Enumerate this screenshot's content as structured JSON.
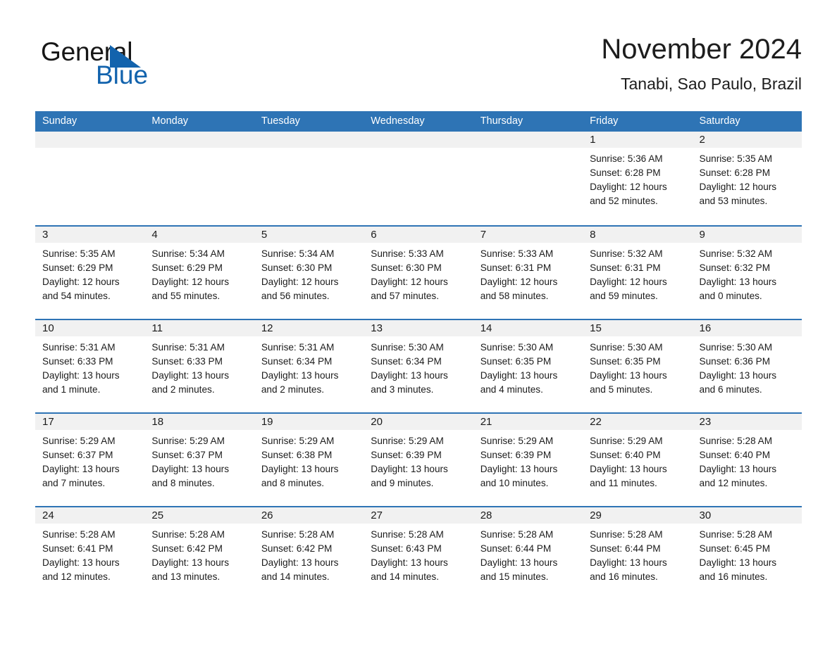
{
  "logo": {
    "word_one": "General",
    "word_two": "Blue",
    "triangle_icon": "triangle-icon",
    "colors": {
      "black": "#161616",
      "blue": "#1263ad"
    }
  },
  "header": {
    "title": "November 2024",
    "subtitle": "Tanabi, Sao Paulo, Brazil"
  },
  "theme": {
    "header_blue": "#2e74b5",
    "day_band_gray": "#f1f1f1",
    "text": "#1b1b1b"
  },
  "weekdays": [
    "Sunday",
    "Monday",
    "Tuesday",
    "Wednesday",
    "Thursday",
    "Friday",
    "Saturday"
  ],
  "weeks": [
    [
      {
        "day": "",
        "lines": []
      },
      {
        "day": "",
        "lines": []
      },
      {
        "day": "",
        "lines": []
      },
      {
        "day": "",
        "lines": []
      },
      {
        "day": "",
        "lines": []
      },
      {
        "day": "1",
        "lines": [
          "Sunrise: 5:36 AM",
          "Sunset: 6:28 PM",
          "Daylight: 12 hours",
          "and 52 minutes."
        ]
      },
      {
        "day": "2",
        "lines": [
          "Sunrise: 5:35 AM",
          "Sunset: 6:28 PM",
          "Daylight: 12 hours",
          "and 53 minutes."
        ]
      }
    ],
    [
      {
        "day": "3",
        "lines": [
          "Sunrise: 5:35 AM",
          "Sunset: 6:29 PM",
          "Daylight: 12 hours",
          "and 54 minutes."
        ]
      },
      {
        "day": "4",
        "lines": [
          "Sunrise: 5:34 AM",
          "Sunset: 6:29 PM",
          "Daylight: 12 hours",
          "and 55 minutes."
        ]
      },
      {
        "day": "5",
        "lines": [
          "Sunrise: 5:34 AM",
          "Sunset: 6:30 PM",
          "Daylight: 12 hours",
          "and 56 minutes."
        ]
      },
      {
        "day": "6",
        "lines": [
          "Sunrise: 5:33 AM",
          "Sunset: 6:30 PM",
          "Daylight: 12 hours",
          "and 57 minutes."
        ]
      },
      {
        "day": "7",
        "lines": [
          "Sunrise: 5:33 AM",
          "Sunset: 6:31 PM",
          "Daylight: 12 hours",
          "and 58 minutes."
        ]
      },
      {
        "day": "8",
        "lines": [
          "Sunrise: 5:32 AM",
          "Sunset: 6:31 PM",
          "Daylight: 12 hours",
          "and 59 minutes."
        ]
      },
      {
        "day": "9",
        "lines": [
          "Sunrise: 5:32 AM",
          "Sunset: 6:32 PM",
          "Daylight: 13 hours",
          "and 0 minutes."
        ]
      }
    ],
    [
      {
        "day": "10",
        "lines": [
          "Sunrise: 5:31 AM",
          "Sunset: 6:33 PM",
          "Daylight: 13 hours",
          "and 1 minute."
        ]
      },
      {
        "day": "11",
        "lines": [
          "Sunrise: 5:31 AM",
          "Sunset: 6:33 PM",
          "Daylight: 13 hours",
          "and 2 minutes."
        ]
      },
      {
        "day": "12",
        "lines": [
          "Sunrise: 5:31 AM",
          "Sunset: 6:34 PM",
          "Daylight: 13 hours",
          "and 2 minutes."
        ]
      },
      {
        "day": "13",
        "lines": [
          "Sunrise: 5:30 AM",
          "Sunset: 6:34 PM",
          "Daylight: 13 hours",
          "and 3 minutes."
        ]
      },
      {
        "day": "14",
        "lines": [
          "Sunrise: 5:30 AM",
          "Sunset: 6:35 PM",
          "Daylight: 13 hours",
          "and 4 minutes."
        ]
      },
      {
        "day": "15",
        "lines": [
          "Sunrise: 5:30 AM",
          "Sunset: 6:35 PM",
          "Daylight: 13 hours",
          "and 5 minutes."
        ]
      },
      {
        "day": "16",
        "lines": [
          "Sunrise: 5:30 AM",
          "Sunset: 6:36 PM",
          "Daylight: 13 hours",
          "and 6 minutes."
        ]
      }
    ],
    [
      {
        "day": "17",
        "lines": [
          "Sunrise: 5:29 AM",
          "Sunset: 6:37 PM",
          "Daylight: 13 hours",
          "and 7 minutes."
        ]
      },
      {
        "day": "18",
        "lines": [
          "Sunrise: 5:29 AM",
          "Sunset: 6:37 PM",
          "Daylight: 13 hours",
          "and 8 minutes."
        ]
      },
      {
        "day": "19",
        "lines": [
          "Sunrise: 5:29 AM",
          "Sunset: 6:38 PM",
          "Daylight: 13 hours",
          "and 8 minutes."
        ]
      },
      {
        "day": "20",
        "lines": [
          "Sunrise: 5:29 AM",
          "Sunset: 6:39 PM",
          "Daylight: 13 hours",
          "and 9 minutes."
        ]
      },
      {
        "day": "21",
        "lines": [
          "Sunrise: 5:29 AM",
          "Sunset: 6:39 PM",
          "Daylight: 13 hours",
          "and 10 minutes."
        ]
      },
      {
        "day": "22",
        "lines": [
          "Sunrise: 5:29 AM",
          "Sunset: 6:40 PM",
          "Daylight: 13 hours",
          "and 11 minutes."
        ]
      },
      {
        "day": "23",
        "lines": [
          "Sunrise: 5:28 AM",
          "Sunset: 6:40 PM",
          "Daylight: 13 hours",
          "and 12 minutes."
        ]
      }
    ],
    [
      {
        "day": "24",
        "lines": [
          "Sunrise: 5:28 AM",
          "Sunset: 6:41 PM",
          "Daylight: 13 hours",
          "and 12 minutes."
        ]
      },
      {
        "day": "25",
        "lines": [
          "Sunrise: 5:28 AM",
          "Sunset: 6:42 PM",
          "Daylight: 13 hours",
          "and 13 minutes."
        ]
      },
      {
        "day": "26",
        "lines": [
          "Sunrise: 5:28 AM",
          "Sunset: 6:42 PM",
          "Daylight: 13 hours",
          "and 14 minutes."
        ]
      },
      {
        "day": "27",
        "lines": [
          "Sunrise: 5:28 AM",
          "Sunset: 6:43 PM",
          "Daylight: 13 hours",
          "and 14 minutes."
        ]
      },
      {
        "day": "28",
        "lines": [
          "Sunrise: 5:28 AM",
          "Sunset: 6:44 PM",
          "Daylight: 13 hours",
          "and 15 minutes."
        ]
      },
      {
        "day": "29",
        "lines": [
          "Sunrise: 5:28 AM",
          "Sunset: 6:44 PM",
          "Daylight: 13 hours",
          "and 16 minutes."
        ]
      },
      {
        "day": "30",
        "lines": [
          "Sunrise: 5:28 AM",
          "Sunset: 6:45 PM",
          "Daylight: 13 hours",
          "and 16 minutes."
        ]
      }
    ]
  ]
}
